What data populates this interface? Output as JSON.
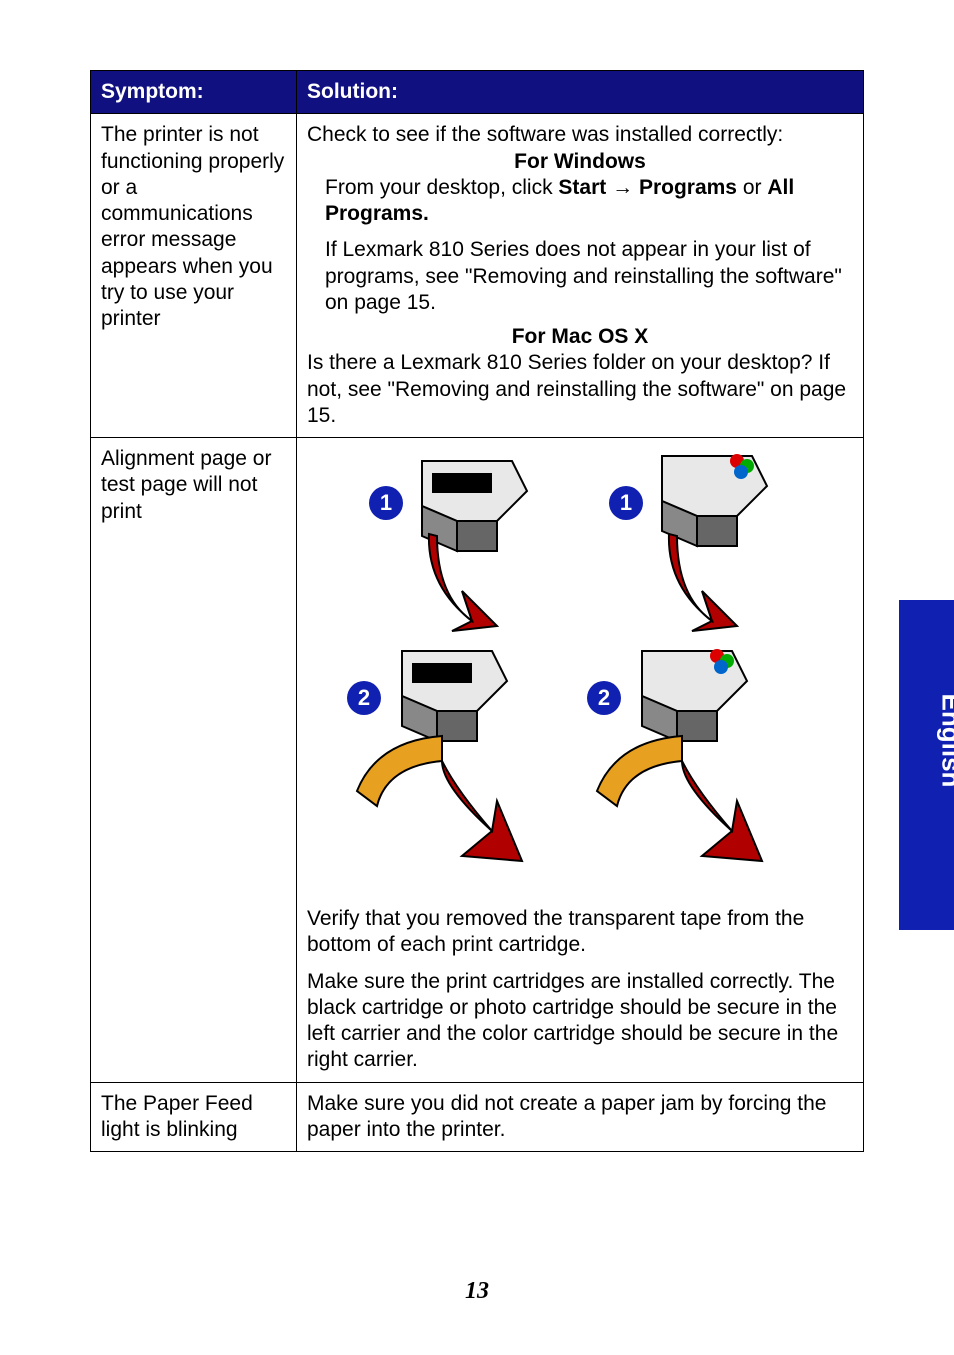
{
  "headers": {
    "symptom": "Symptom:",
    "solution": "Solution:"
  },
  "row1": {
    "symptom": "The printer is not functioning properly or a communications error message appears when you try to use your printer",
    "check": "Check to see if the software was installed correctly:",
    "windows_heading": "For Windows",
    "win_line_a": "From your desktop, click ",
    "win_start": "Start",
    "win_arrow": " → ",
    "win_programs": "Programs",
    "win_or": " or ",
    "win_all_programs": "All Programs",
    "win_period": ".",
    "win_para2": "If Lexmark 810 Series does not appear in your list of programs, see \"Removing and reinstalling the software\" on page 15.",
    "mac_heading": "For Mac OS X",
    "mac_para": "Is there a Lexmark 810 Series folder on your desktop? If not, see \"Removing and reinstalling the software\" on page 15."
  },
  "row2": {
    "symptom": "Alignment page or test page will not print",
    "verify": "Verify that you removed the transparent tape from the bottom of each print cartridge.",
    "make_sure": "Make sure the print cartridges are installed correctly. The black cartridge or photo cartridge should be secure in the left carrier and the color cartridge should be secure in the right carrier.",
    "num1": "1",
    "num2": "2"
  },
  "row3": {
    "symptom": "The Paper Feed light is blinking",
    "solution": "Make sure you did not create a paper jam by forcing the paper into the printer."
  },
  "side_tab": "English",
  "page_number": "13"
}
